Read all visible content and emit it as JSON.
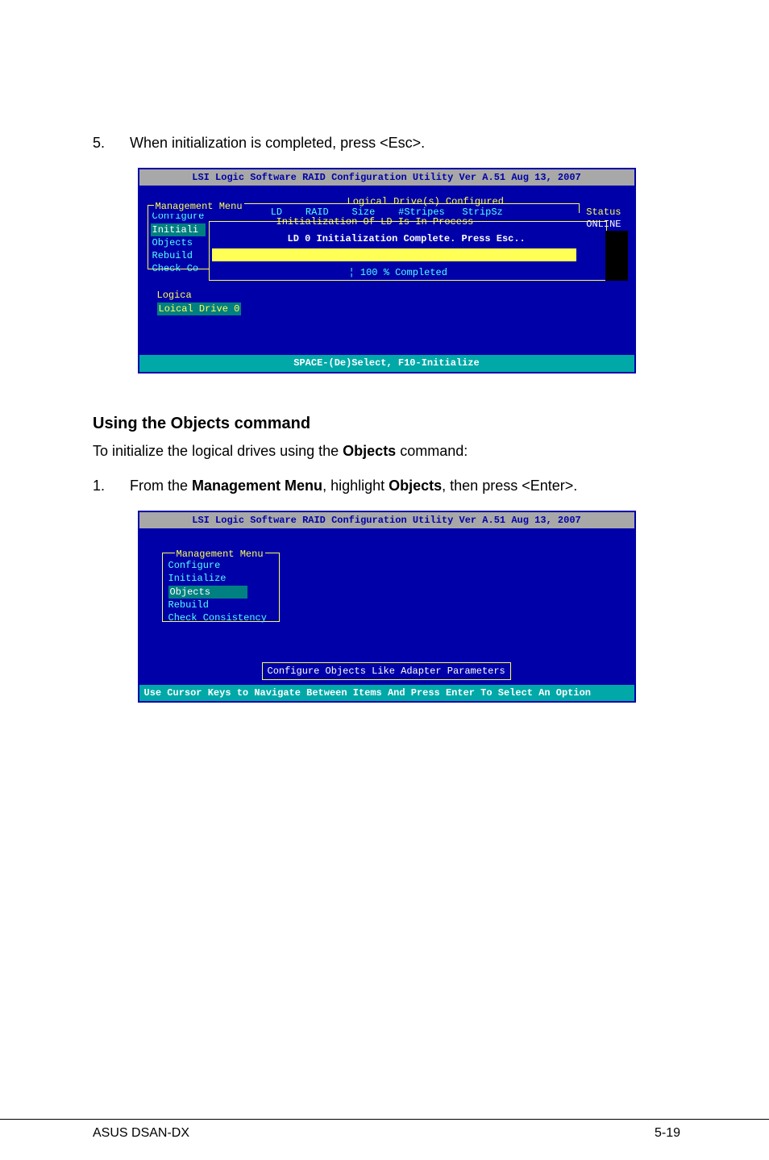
{
  "step5": {
    "num": "5.",
    "text": "When initialization is completed, press <Esc>."
  },
  "bios1": {
    "title": "LSI Logic Software RAID Configuration Utility Ver A.51 Aug 13, 2007",
    "mgmt_title": "Management Menu",
    "menu": {
      "configure": "Configure",
      "initialize": "Initiali",
      "objects": "Objects",
      "rebuild": "Rebuild",
      "check": "Check Co"
    },
    "logical_title": "Logical Drive(s) Configured",
    "ld_header": " LD    RAID    Size    #Stripes   StripSz",
    "status": "Status",
    "online": "ONLINE",
    "init_title": "Initialization Of LD Is In Process",
    "ld0_msg": "LD 0 Initialization Complete. Press Esc..",
    "progress": "¦ 100 % Completed",
    "logic_title": "Logica",
    "loical": "Loical Drive 0",
    "footer": "SPACE-(De)Select, F10-Initialize"
  },
  "section": {
    "heading": "Using the Objects command",
    "intro_pre": "To initialize the logical drives using the ",
    "intro_bold": "Objects",
    "intro_post": " command:"
  },
  "step1": {
    "num": "1.",
    "pre": "From the ",
    "b1": "Management Menu",
    "mid": ", highlight ",
    "b2": "Objects",
    "post": ", then press <Enter>."
  },
  "bios2": {
    "title": "LSI Logic Software RAID Configuration Utility Ver A.51 Aug 13, 2007",
    "mgmt_title": "Management Menu",
    "menu": {
      "configure": "Configure",
      "initialize": "Initialize",
      "objects": "Objects",
      "rebuild": "Rebuild",
      "check": "Check Consistency"
    },
    "config_box": "Configure Objects Like Adapter Parameters",
    "footer": "Use Cursor Keys to Navigate Between Items And Press Enter To Select An Option"
  },
  "page_footer": {
    "left": "ASUS DSAN-DX",
    "right": "5-19"
  }
}
